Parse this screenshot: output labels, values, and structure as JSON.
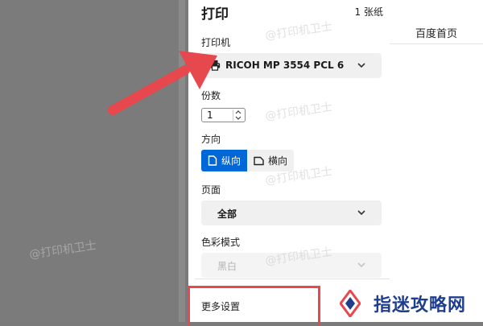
{
  "print_dialog": {
    "title": "打印",
    "sheet_count": "1 张纸",
    "printer": {
      "label": "打印机",
      "selected": "RICOH MP 3554 PCL 6",
      "icon": "printer-icon"
    },
    "copies": {
      "label": "份数",
      "value": "1"
    },
    "orientation": {
      "label": "方向",
      "options": [
        {
          "label": "纵向",
          "selected": true
        },
        {
          "label": "横向",
          "selected": false
        }
      ]
    },
    "pages": {
      "label": "页面",
      "selected": "全部"
    },
    "color_mode": {
      "label": "色彩模式",
      "selected": "黑白",
      "disabled": true
    },
    "more_settings": "更多设置"
  },
  "background_page": {
    "nav_link": "百度首页"
  },
  "watermark": {
    "text": "@打印机卫士"
  },
  "logo": {
    "text": "指迷攻略网"
  },
  "colors": {
    "accent": "#0067d6",
    "annotation_red": "#e6484d",
    "logo_blue": "#1f3f8e"
  }
}
